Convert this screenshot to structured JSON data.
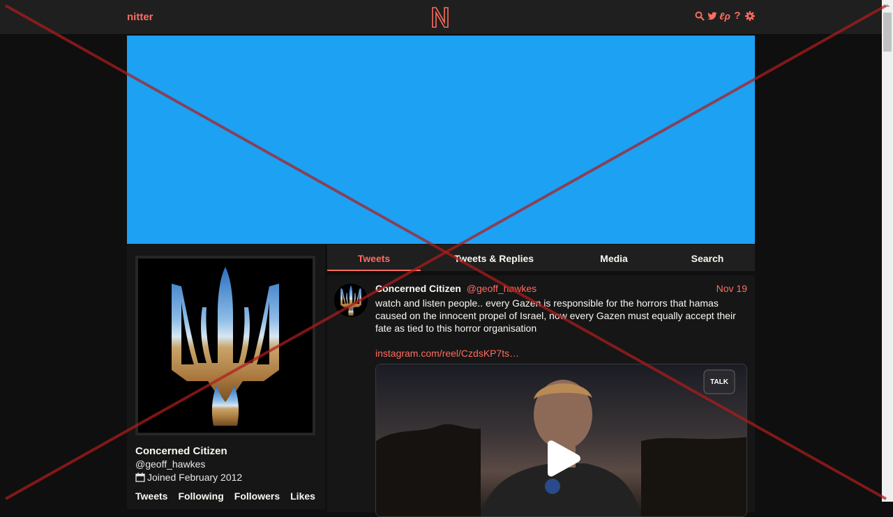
{
  "navbar": {
    "brand": "nitter",
    "icons": [
      "search-icon",
      "twitter-bird-icon",
      "rss-icon",
      "help-icon",
      "gear-icon"
    ],
    "rss_glyph": "ℓρ",
    "help_glyph": "?"
  },
  "colors": {
    "accent": "#ff6c60",
    "banner": "#1da1f2",
    "background": "#0f0f0f",
    "panel": "#161616",
    "navbar": "#1f1f1f"
  },
  "profile": {
    "name": "Concerned Citizen",
    "handle": "@geoff_hawkes",
    "joined": "Joined February 2012",
    "stats": [
      "Tweets",
      "Following",
      "Followers",
      "Likes"
    ]
  },
  "tabs": [
    {
      "label": "Tweets",
      "active": true
    },
    {
      "label": "Tweets & Replies",
      "active": false
    },
    {
      "label": "Media",
      "active": false
    },
    {
      "label": "Search",
      "active": false
    }
  ],
  "tweet": {
    "name": "Concerned Citizen",
    "username": "@geoff_hawkes",
    "date": "Nov 19",
    "text": "watch and listen people.. every Gazen is responsible for the horrors that hamas caused on the innocent propel of Israel, now every Gazen must equally accept their fate as tied to this horror organisation",
    "link": "instagram.com/reel/CzdsKP7ts…",
    "media_logo": "TALK"
  }
}
